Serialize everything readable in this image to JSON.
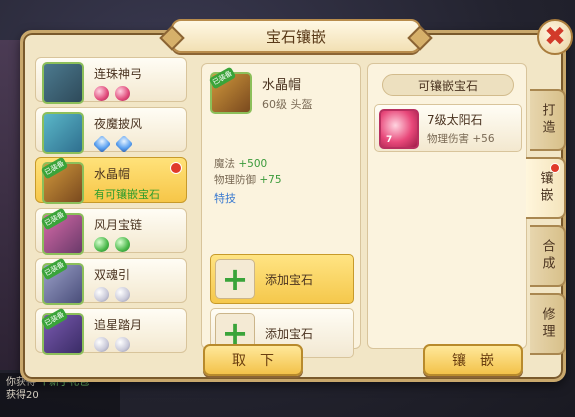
{
  "title": "宝石镶嵌",
  "close_label": "✖",
  "items": [
    {
      "name": "连珠神弓",
      "sub": "",
      "gems": [
        "red",
        "red"
      ],
      "dot": false,
      "selected": false,
      "thumb": "c1",
      "badge": ""
    },
    {
      "name": "夜魔披风",
      "sub": "",
      "gems": [
        "blue",
        "blue"
      ],
      "dot": false,
      "selected": false,
      "thumb": "c2",
      "badge": ""
    },
    {
      "name": "水晶帽",
      "sub": "有可镶嵌宝石",
      "gems": [],
      "dot": true,
      "selected": true,
      "thumb": "c3",
      "badge": "已装备"
    },
    {
      "name": "风月宝链",
      "sub": "",
      "gems": [
        "green",
        "green"
      ],
      "dot": false,
      "selected": false,
      "thumb": "c4",
      "badge": "已装备"
    },
    {
      "name": "双魂引",
      "sub": "",
      "gems": [
        "white",
        "white"
      ],
      "dot": false,
      "selected": false,
      "thumb": "c5",
      "badge": "已装备"
    },
    {
      "name": "追星踏月",
      "sub": "",
      "gems": [
        "white",
        "white"
      ],
      "dot": false,
      "selected": false,
      "thumb": "c6",
      "badge": "已装备"
    }
  ],
  "equip": {
    "name": "水晶帽",
    "level": "60级 头盔",
    "badge": "已装备",
    "stats": [
      {
        "label": "魔法",
        "value": "+500"
      },
      {
        "label": "物理防御",
        "value": "+75"
      }
    ],
    "special": "特技"
  },
  "slots": [
    {
      "label": "添加宝石",
      "active": true,
      "icon": "plus-icon"
    },
    {
      "label": "添加宝石",
      "active": false,
      "icon": "plus-icon"
    }
  ],
  "right": {
    "header": "可镶嵌宝石",
    "stone": {
      "name": "7级太阳石",
      "level_badge": "7",
      "attr_label": "物理伤害",
      "attr_value": "+56",
      "icon": "sun-stone-icon"
    }
  },
  "tabs": [
    {
      "label": "打造",
      "active": false,
      "dot": false
    },
    {
      "label": "镶嵌",
      "active": true,
      "dot": true
    },
    {
      "label": "合成",
      "active": false,
      "dot": false
    },
    {
      "label": "修理",
      "active": false,
      "dot": false
    }
  ],
  "buttons": {
    "remove": "取下",
    "inlay": "镶嵌"
  },
  "chat": {
    "line1": "你获得",
    "line1_item": "个新手礼包",
    "line2": "获得20"
  },
  "colors": {
    "accent": "#f3c24a",
    "panel": "#f2e6c6",
    "gem_green_text": "#2c9c2c",
    "special_blue": "#3a7ad0",
    "alert_red": "#e03a2a"
  }
}
